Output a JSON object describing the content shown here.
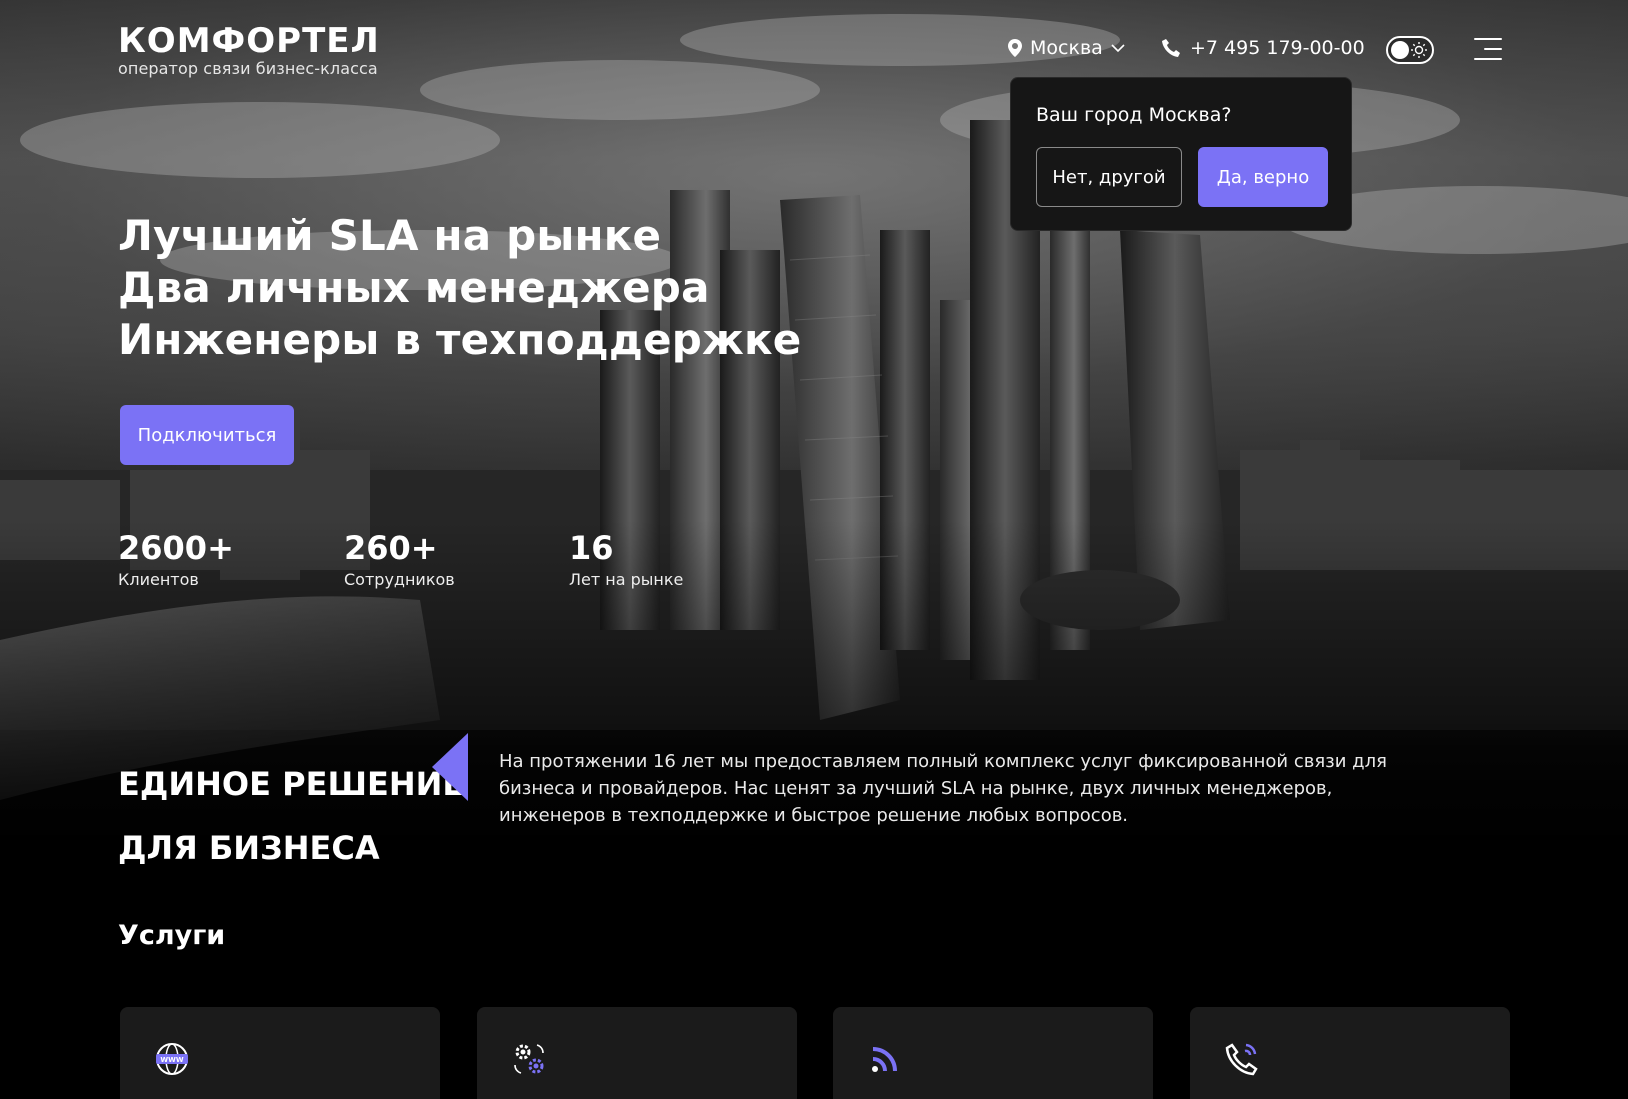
{
  "header": {
    "logo_title": "КОМФОРТЕЛ",
    "logo_subtitle": "оператор связи бизнес-класса",
    "city": "Москва",
    "phone": "+7 495 179-00-00"
  },
  "city_popup": {
    "question": "Ваш город Москва?",
    "no_label": "Нет, другой",
    "yes_label": "Да, верно"
  },
  "hero": {
    "lines": [
      "Лучший SLA на рынке",
      "Два личных менеджера",
      "Инженеры в техподдержке"
    ],
    "cta_label": "Подключиться",
    "stats": [
      {
        "value": "2600+",
        "label": "Клиентов"
      },
      {
        "value": "260+",
        "label": "Сотрудников"
      },
      {
        "value": "16",
        "label": "Лет на рынке"
      }
    ]
  },
  "solution": {
    "title_line1": "ЕДИНОЕ РЕШЕНИЕ",
    "title_line2": "ДЛЯ БИЗНЕСА",
    "text": "На протяжении 16 лет мы предоставляем полный комплекс услуг фиксированной связи для бизнеса и провайдеров. Нас ценят за лучший SLA на рынке, двух личных менеджеров, инженеров в техподдержке и быстрое решение любых вопросов."
  },
  "services": {
    "title": "Услуги",
    "cards": [
      {
        "icon": "www-globe-icon"
      },
      {
        "icon": "gears-icon"
      },
      {
        "icon": "rss-feed-icon"
      },
      {
        "icon": "phone-call-icon"
      }
    ]
  },
  "colors": {
    "accent": "#7b72f5",
    "popup_bg": "#161616",
    "card_bg": "#1b1b1b"
  }
}
